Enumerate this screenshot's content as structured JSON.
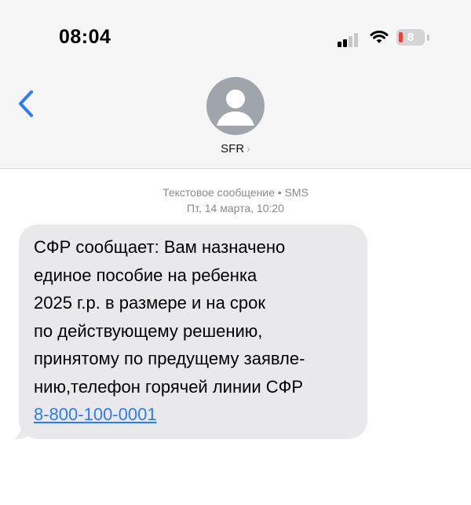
{
  "status_bar": {
    "time": "08:04",
    "battery_level": "8"
  },
  "contact": {
    "name": "SFR"
  },
  "message_meta": {
    "type_label": "Текстовое сообщение • SMS",
    "timestamp": "Пт, 14 марта, 10:20"
  },
  "message": {
    "lines": [
      "СФР сообщает: Вам назначено",
      "единое пособие на ребенка",
      "2025 г.р. в размере и на срок",
      "по действующему решению,",
      "принятому по предущему заявле-",
      "нию,телефон горячей линии СФР"
    ],
    "phone_link": "8-800-100-0001"
  },
  "colors": {
    "accent": "#2f7bf5",
    "bubble": "#e9e9eb",
    "header_bg": "#f6f6f6",
    "battery_low": "#e8443b"
  },
  "icons": {
    "back": "chevron-left-icon",
    "avatar": "person-icon",
    "signal": "cellular-signal-icon",
    "wifi": "wifi-icon",
    "battery": "battery-icon"
  }
}
